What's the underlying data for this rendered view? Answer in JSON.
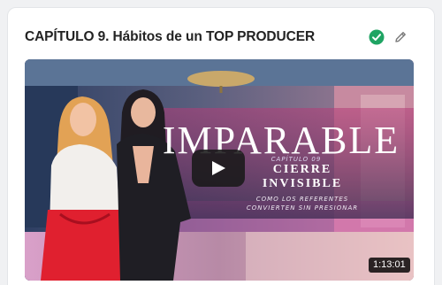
{
  "card": {
    "title": "CAPÍTULO 9. Hábitos de un TOP PRODUCER"
  },
  "icons": {
    "status": "check-circle-icon",
    "edit": "pencil-icon",
    "play": "play-icon"
  },
  "video": {
    "headline": "IMPARABLE",
    "chapter_label": "CAPÍTULO 09",
    "subtitle_line1": "CIERRE",
    "subtitle_line2": "INVISIBLE",
    "tagline_line1": "COMO LOS REFERENTES",
    "tagline_line2": "CONVIERTEN SIN PRESIONAR",
    "duration": "1:13:01"
  },
  "colors": {
    "status_green": "#1fa463",
    "banner_purple": "#3a2a4f"
  }
}
